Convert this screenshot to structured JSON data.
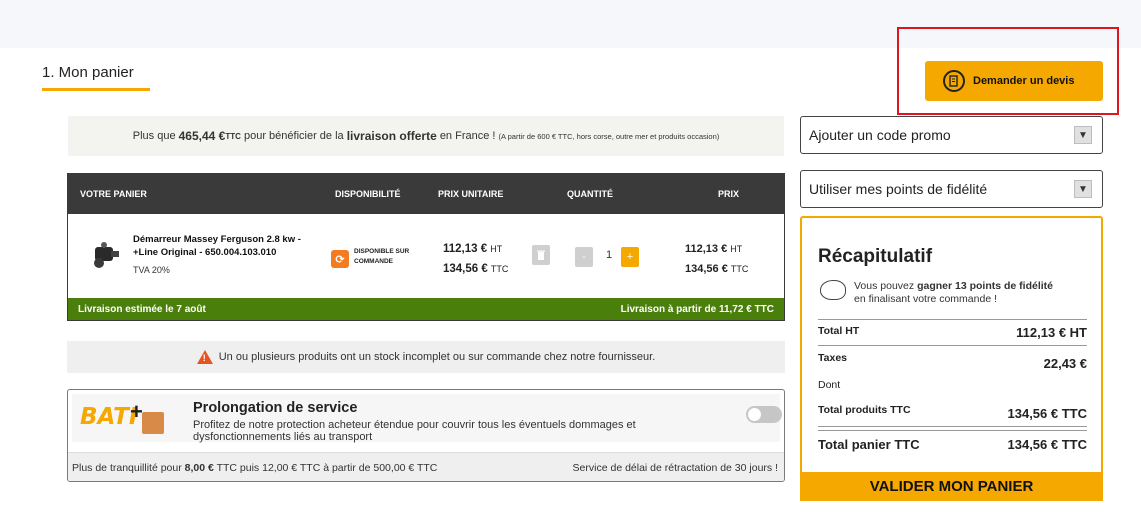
{
  "step": {
    "title": "1. Mon panier"
  },
  "quote_button": {
    "label": "Demander un devis",
    "icon": "document-edit-icon"
  },
  "banner": {
    "prefix": "Plus que",
    "amount": "465,44 €",
    "amount_suffix": "TTC",
    "middle": "pour bénéficier de la",
    "bold": "livraison offerte",
    "after": "en France !",
    "note": "(A partir de 600 € TTC, hors corse, outre mer et produits occasion)"
  },
  "cart": {
    "headers": {
      "product": "VOTRE PANIER",
      "availability": "DISPONIBILITÉ",
      "unit_price": "PRIX UNITAIRE",
      "quantity": "QUANTITÉ",
      "price": "PRIX"
    },
    "item": {
      "name": "Démarreur Massey Ferguson 2.8 kw - +Line Original - 650.004.103.010",
      "tva": "TVA 20%",
      "availability": "DISPONIBLE SUR COMMANDE",
      "unit_ht": "112,13 €",
      "unit_ht_suffix": "HT",
      "unit_ttc": "134,56 €",
      "unit_ttc_suffix": "TTC",
      "quantity": "1",
      "total_ht": "112,13 €",
      "total_ht_suffix": "HT",
      "total_ttc": "134,56 €",
      "total_ttc_suffix": "TTC",
      "minus": "-",
      "plus": "+"
    },
    "footer": {
      "left": "Livraison estimée le 7 août",
      "right": "Livraison à partir de 11,72 € TTC"
    }
  },
  "warning": {
    "text": "Un ou plusieurs produits ont un stock incomplet ou sur commande chez notre fournisseur."
  },
  "service": {
    "logo": "BATI",
    "logo_plus": "+",
    "title": "Prolongation de service",
    "description": "Profitez de notre protection acheteur étendue pour couvrir tous les éventuels dommages et dysfonctionnements liés au transport",
    "price_prefix": "Plus de tranquillité pour",
    "price_bold": "8,00 €",
    "price_suffix": "TTC puis 12,00 € TTC à partir de 500,00 € TTC",
    "right_note": "Service de délai de rétractation de 30 jours !",
    "toggle_on": false
  },
  "promo": {
    "label": "Ajouter un code promo"
  },
  "loyalty": {
    "label": "Utiliser mes points de fidélité"
  },
  "recap": {
    "title": "Récapitulatif",
    "fid_prefix": "Vous pouvez",
    "fid_bold": "gagner 13 points de fidélité",
    "fid_suffix": "en finalisant votre commande !",
    "total_ht_label": "Total HT",
    "total_ht_value": "112,13 € HT",
    "taxes_label": "Taxes",
    "taxes_value": "22,43 €",
    "dont_label": "Dont",
    "total_products_label": "Total produits TTC",
    "total_products_value": "134,56 € TTC",
    "total_cart_label": "Total panier TTC",
    "total_cart_value": "134,56 € TTC"
  },
  "validate_button": {
    "label": "VALIDER MON PANIER"
  },
  "colors": {
    "accent": "#f5a800",
    "dark_header": "#3a3a3a",
    "delivery_green": "#4b7f0c",
    "highlight_red": "#e0141e"
  }
}
